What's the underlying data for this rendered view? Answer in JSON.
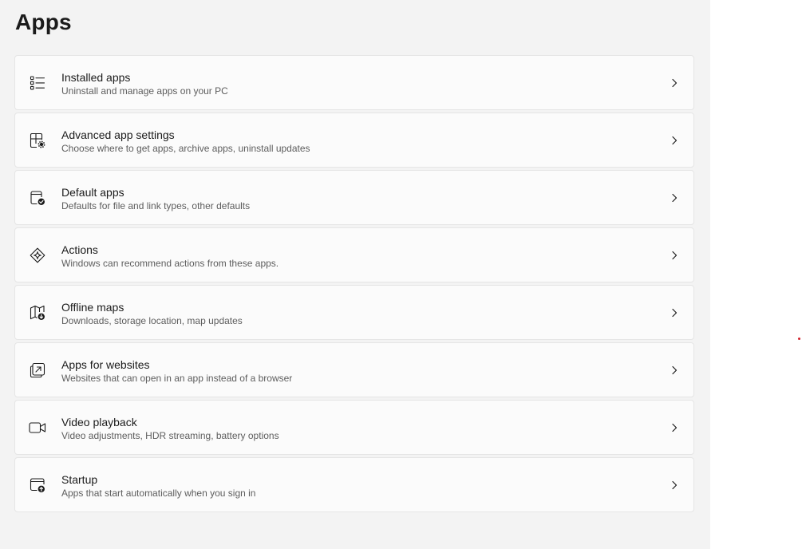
{
  "page": {
    "title": "Apps"
  },
  "cards": [
    {
      "title": "Installed apps",
      "description": "Uninstall and manage apps on your PC",
      "icon": "installed-apps-icon"
    },
    {
      "title": "Advanced app settings",
      "description": "Choose where to get apps, archive apps, uninstall updates",
      "icon": "advanced-app-settings-icon"
    },
    {
      "title": "Default apps",
      "description": "Defaults for file and link types, other defaults",
      "icon": "default-apps-icon"
    },
    {
      "title": "Actions",
      "description": "Windows can recommend actions from these apps.",
      "icon": "actions-icon"
    },
    {
      "title": "Offline maps",
      "description": "Downloads, storage location, map updates",
      "icon": "offline-maps-icon"
    },
    {
      "title": "Apps for websites",
      "description": "Websites that can open in an app instead of a browser",
      "icon": "apps-for-websites-icon"
    },
    {
      "title": "Video playback",
      "description": "Video adjustments, HDR streaming, battery options",
      "icon": "video-playback-icon"
    },
    {
      "title": "Startup",
      "description": "Apps that start automatically when you sign in",
      "icon": "startup-icon"
    }
  ],
  "colors": {
    "pane_background": "#f3f3f3",
    "card_background": "#fbfbfb",
    "card_border": "#e5e5e5",
    "title_text": "#1b1b1b",
    "description_text": "#5d5d5d",
    "marker_dot": "#d2202a"
  }
}
